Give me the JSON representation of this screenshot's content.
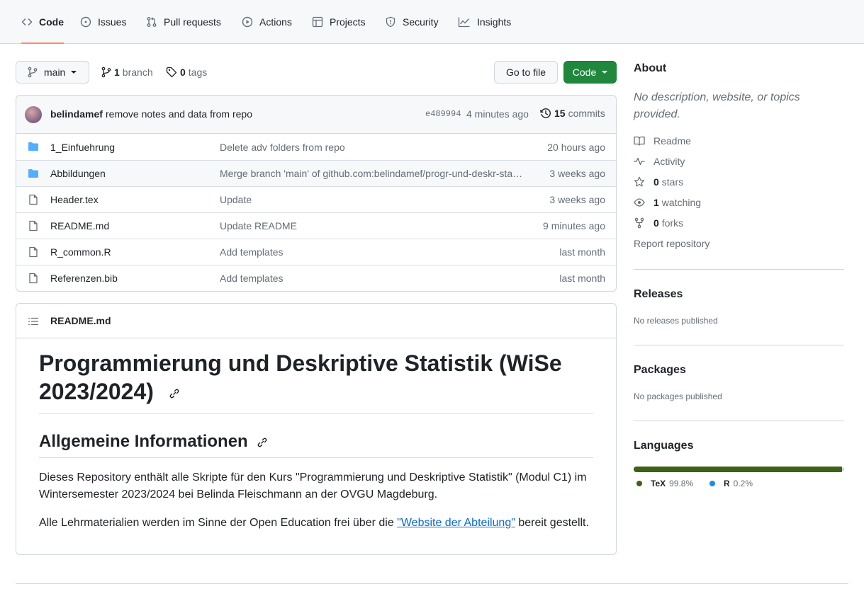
{
  "nav": {
    "tabs": [
      {
        "label": "Code",
        "icon": "code-icon"
      },
      {
        "label": "Issues",
        "icon": "issue-icon"
      },
      {
        "label": "Pull requests",
        "icon": "pull-request-icon"
      },
      {
        "label": "Actions",
        "icon": "play-icon"
      },
      {
        "label": "Projects",
        "icon": "table-icon"
      },
      {
        "label": "Security",
        "icon": "shield-icon"
      },
      {
        "label": "Insights",
        "icon": "graph-icon"
      }
    ],
    "selected": "Code"
  },
  "toolbar": {
    "branch": "main",
    "branch_count": "1",
    "branch_label": "branch",
    "tag_count": "0",
    "tag_label": "tags",
    "go_to_file": "Go to file",
    "code_button": "Code"
  },
  "commit": {
    "author": "belindamef",
    "message": "remove notes and data from repo",
    "sha": "e489994",
    "time": "4 minutes ago",
    "count": "15",
    "count_label": "commits"
  },
  "files": [
    {
      "type": "folder",
      "name": "1_Einfuehrung",
      "message": "Delete adv folders from repo",
      "age": "20 hours ago"
    },
    {
      "type": "folder",
      "name": "Abbildungen",
      "message": "Merge branch 'main' of github.com:belindamef/progr-und-deskr-statistik",
      "age": "3 weeks ago"
    },
    {
      "type": "file",
      "name": "Header.tex",
      "message": "Update",
      "age": "3 weeks ago"
    },
    {
      "type": "file",
      "name": "README.md",
      "message": "Update README",
      "age": "9 minutes ago"
    },
    {
      "type": "file",
      "name": "R_common.R",
      "message": "Add templates",
      "age": "last month"
    },
    {
      "type": "file",
      "name": "Referenzen.bib",
      "message": "Add templates",
      "age": "last month"
    }
  ],
  "readme": {
    "filename": "README.md",
    "title_line1": "Programmierung und Deskriptive Statistik (WiSe",
    "title_line2": "2023/2024)",
    "section": "Allgemeine Informationen",
    "para1": "Dieses Repository enthält alle Skripte für den Kurs \"Programmierung und Deskriptive Statistik\" (Modul C1) im Wintersemester 2023/2024 bei Belinda Fleischmann an der OVGU Magdeburg.",
    "para2_before": "Alle Lehrmaterialien werden im Sinne der Open Education frei über die ",
    "para2_link": "\"Website der Abteilung\"",
    "para2_after": " bereit gestellt."
  },
  "about": {
    "heading": "About",
    "description": "No description, website, or topics provided.",
    "readme": "Readme",
    "activity": "Activity",
    "stars_count": "0",
    "stars_label": "stars",
    "watching_count": "1",
    "watching_label": "watching",
    "forks_count": "0",
    "forks_label": "forks",
    "report": "Report repository"
  },
  "releases": {
    "heading": "Releases",
    "text": "No releases published"
  },
  "packages": {
    "heading": "Packages",
    "text": "No packages published"
  },
  "languages": {
    "heading": "Languages",
    "items": [
      {
        "name": "TeX",
        "percent": "99.8%",
        "share": 99.8,
        "color": "#3d6117"
      },
      {
        "name": "R",
        "percent": "0.2%",
        "share": 0.2,
        "color": "#198ce7"
      }
    ]
  }
}
